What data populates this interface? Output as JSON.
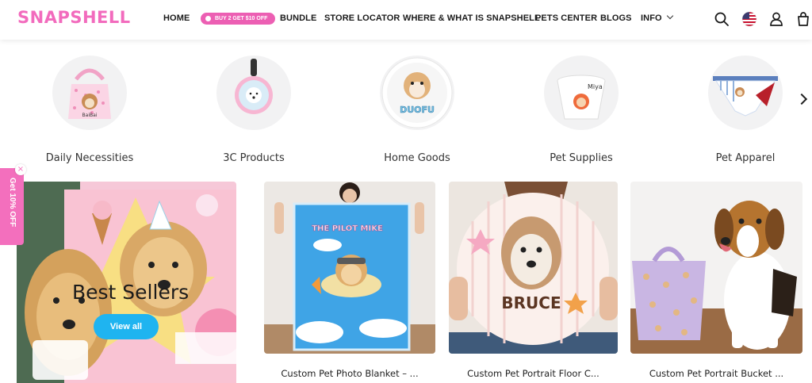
{
  "brand": {
    "logo_text": "SNAPSHELL",
    "accent": "#f26bbd",
    "button_blue": "#1fb4f0"
  },
  "nav": {
    "home": "HOME",
    "promo": "BUY 2 GET $10 OFF",
    "bundle": "BUNDLE",
    "store_locator": "STORE LOCATOR",
    "where_what": "WHERE & WHAT IS SNAPSHELL",
    "pets_center": "PETS CENTER",
    "blogs": "BLOGS",
    "info": "INFO"
  },
  "header_icons": [
    "search-icon",
    "us-flag-icon",
    "account-icon",
    "cart-icon"
  ],
  "categories": [
    {
      "label": "Daily Necessities",
      "icon": "tote-bag"
    },
    {
      "label": "3C Products",
      "icon": "luggage-tag"
    },
    {
      "label": "Home Goods",
      "icon": "hamster-pillow"
    },
    {
      "label": "Pet Supplies",
      "icon": "pet-bowl"
    },
    {
      "label": "Pet Apparel",
      "icon": "pet-bandana"
    }
  ],
  "side_tab": {
    "text": "Get 10% OFF",
    "close": "×"
  },
  "banner": {
    "title": "Best Sellers",
    "button": "View all"
  },
  "products": [
    {
      "title": "Custom Pet Photo Blanket – ..."
    },
    {
      "title": "Custom Pet Portrait Floor C..."
    },
    {
      "title": "Custom Pet Portrait Bucket ..."
    }
  ]
}
